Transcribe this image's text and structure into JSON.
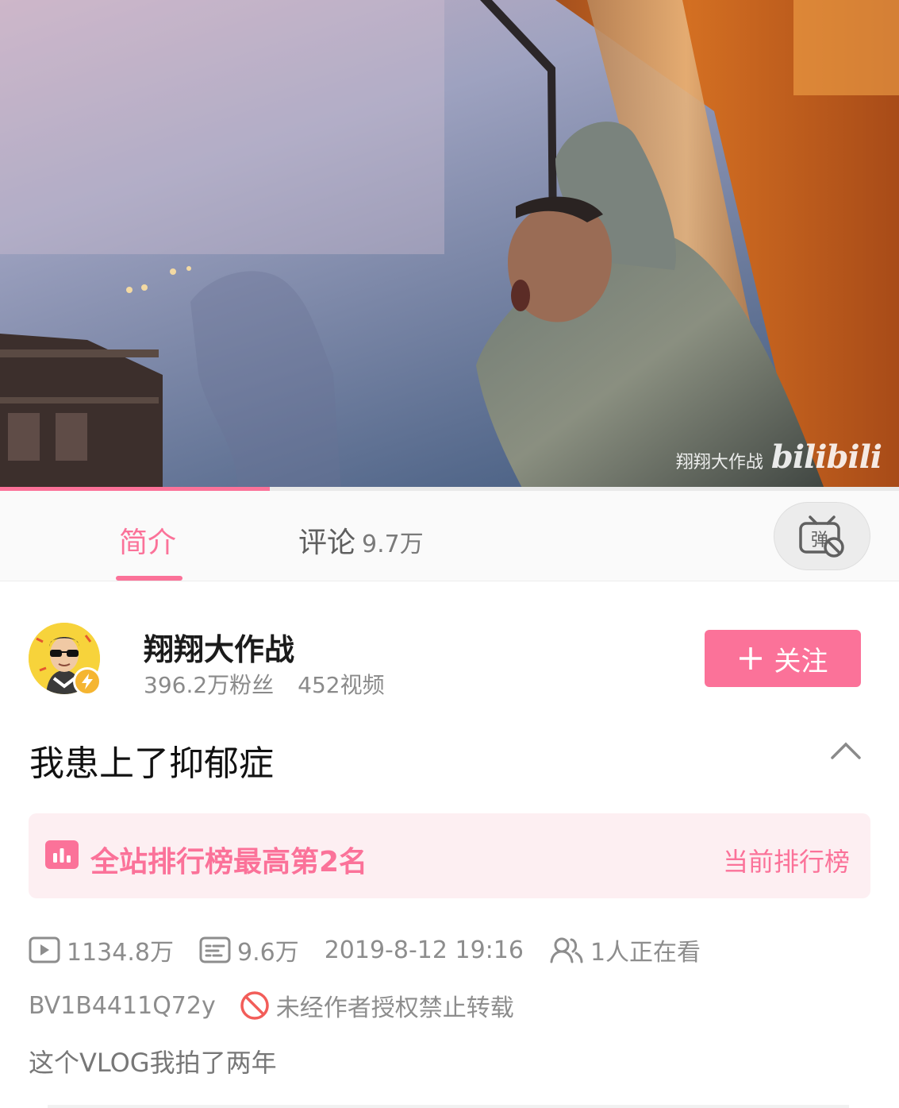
{
  "player": {
    "watermark_author": "翔翔大作战",
    "watermark_logo": "bilibili",
    "progress_fraction": 0.3
  },
  "tabs": {
    "intro_label": "简介",
    "comments_label": "评论",
    "comments_count": "9.7万",
    "danmaku_icon": "danmaku-off-icon"
  },
  "uploader": {
    "name": "翔翔大作战",
    "followers": "396.2万粉丝",
    "videos": "452视频",
    "follow_label": "关注",
    "follow_icon": "plus-icon"
  },
  "video": {
    "title": "我患上了抑郁症",
    "ranking_text": "全站排行榜最高第2名",
    "ranking_link": "当前排行榜",
    "views": "1134.8万",
    "danmaku": "9.6万",
    "pubdate": "2019-8-12 19:16",
    "watching": "1人正在看",
    "bvid": "BV1B4411Q72y",
    "copyright": "未经作者授权禁止转载",
    "description": "这个VLOG我拍了两年"
  },
  "colors": {
    "accent": "#fb7299",
    "banner_bg": "#fdeff2",
    "meta_text": "#8d8d8d"
  }
}
